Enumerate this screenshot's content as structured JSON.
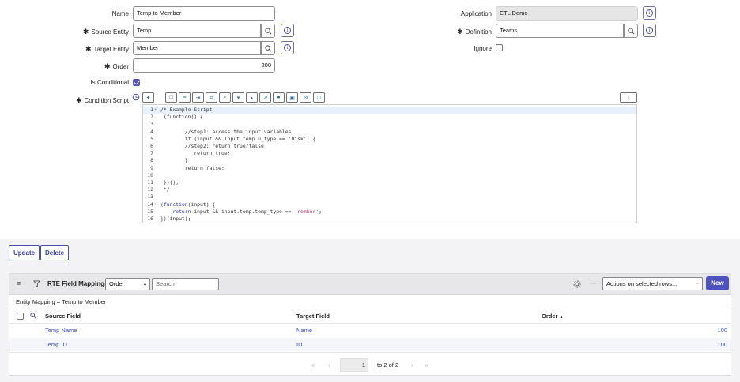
{
  "form": {
    "name": {
      "label": "Name",
      "value": "Temp to Member"
    },
    "source_entity": {
      "label": "Source Entity",
      "value": "Temp"
    },
    "target_entity": {
      "label": "Target Entity",
      "value": "Member"
    },
    "order": {
      "label": "Order",
      "value": "200"
    },
    "is_conditional": {
      "label": "Is Conditional",
      "checked": true
    },
    "condition_script": {
      "label": "Condition Script"
    },
    "application": {
      "label": "Application",
      "value": "ETL Demo"
    },
    "definition": {
      "label": "Definition",
      "value": "Teams"
    },
    "ignore": {
      "label": "Ignore",
      "checked": false
    },
    "required_marker": "✱"
  },
  "editor": {
    "toolbar_icons": [
      "script-assist-icon",
      "comment-icon",
      "format-icon",
      "insert-icon",
      "replace-icon",
      "search-icon",
      "toggle-icon",
      "fold-icon",
      "expand-icon",
      "help-icon",
      "save-icon",
      "snippet-icon",
      "syntax-icon"
    ],
    "lines": [
      {
        "n": "1",
        "fold": true,
        "text": "/* Example Script",
        "kind": "comment"
      },
      {
        "n": "2",
        "text": " (function() {",
        "kind": "comment"
      },
      {
        "n": "3",
        "text": "",
        "kind": "comment"
      },
      {
        "n": "4",
        "text": "        //step1: access the input variables",
        "kind": "comment"
      },
      {
        "n": "5",
        "text": "        if (input && input.temp.u_type == 'Disk') {",
        "kind": "comment"
      },
      {
        "n": "6",
        "text": "        //step2: return true/false",
        "kind": "comment"
      },
      {
        "n": "7",
        "text": "           return true;",
        "kind": "comment"
      },
      {
        "n": "8",
        "text": "        }",
        "kind": "comment"
      },
      {
        "n": "9",
        "text": "        return false;",
        "kind": "comment"
      },
      {
        "n": "10",
        "text": "",
        "kind": "comment"
      },
      {
        "n": "11",
        "text": " })();",
        "kind": "comment"
      },
      {
        "n": "12",
        "text": " */",
        "kind": "comment"
      },
      {
        "n": "13",
        "text": "",
        "kind": "plain"
      },
      {
        "n": "14",
        "fold": true,
        "text": "(function(input) {",
        "kind": "plain"
      },
      {
        "n": "15",
        "text": "    return input && input.temp.temp_type == 'rember';",
        "kind": "plain"
      },
      {
        "n": "16",
        "text": "})(input);",
        "kind": "plain"
      }
    ]
  },
  "actions": {
    "update": "Update",
    "delete": "Delete"
  },
  "related_list": {
    "title": "RTE Field Mappings",
    "search_field_select": "Order",
    "search_placeholder": "Search",
    "actions_select": "Actions on selected rows...",
    "new_label": "New",
    "breadcrumb": "Entity Mapping = Temp to Member",
    "columns": [
      "Source Field",
      "Target Field",
      "Order"
    ],
    "sort_indicator": "▲",
    "rows": [
      {
        "source": "Temp Name",
        "target": "Name",
        "order": "100"
      },
      {
        "source": "Temp ID",
        "target": "ID",
        "order": "100"
      }
    ],
    "pagination": {
      "current": "1",
      "of_text": "to 2 of 2"
    }
  }
}
